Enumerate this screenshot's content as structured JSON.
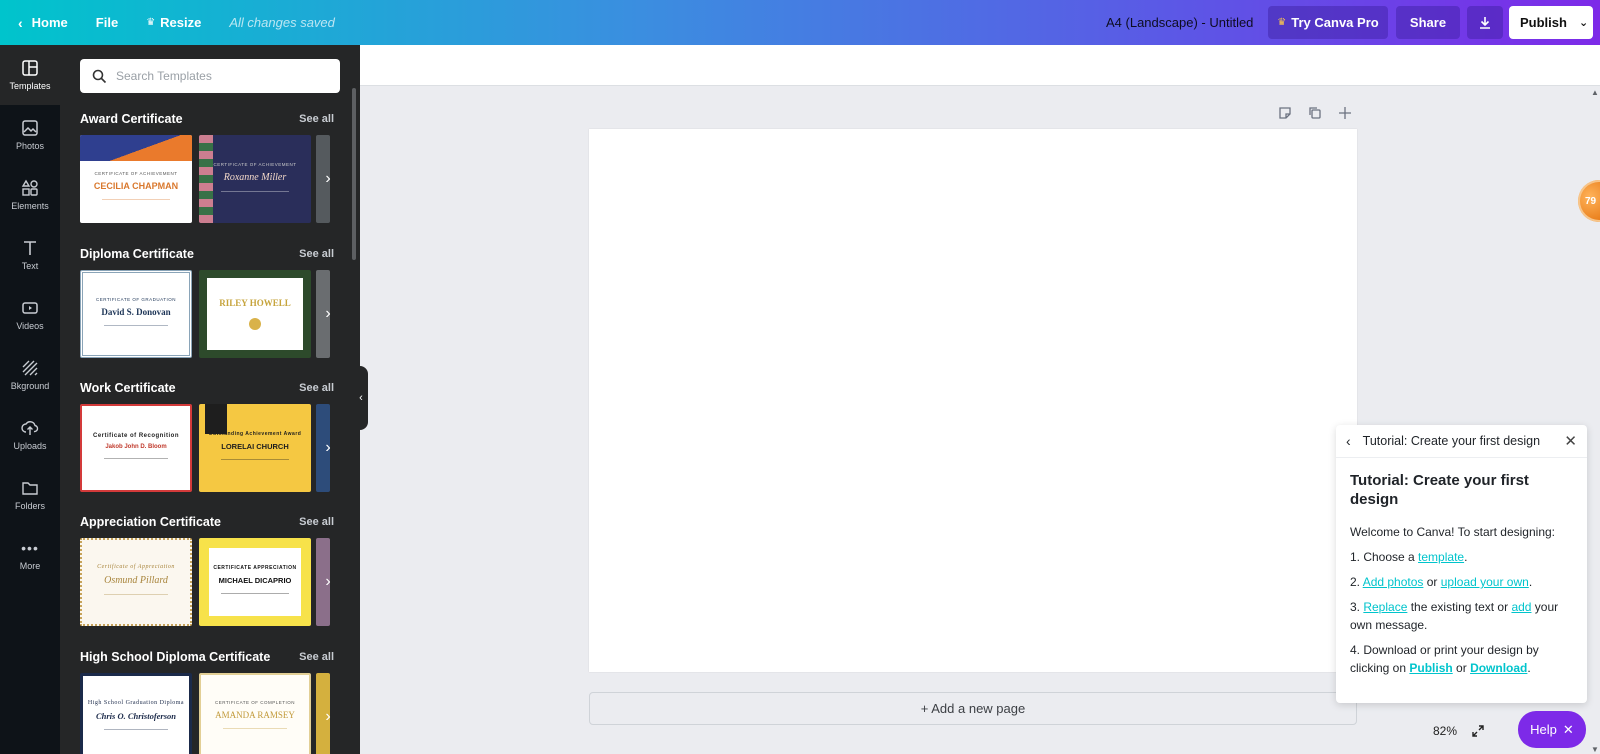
{
  "topbar": {
    "home": "Home",
    "file": "File",
    "resize": "Resize",
    "saved": "All changes saved",
    "doc_title": "A4 (Landscape) - Untitled",
    "try_pro": "Try Canva Pro",
    "share": "Share",
    "publish": "Publish"
  },
  "rail": {
    "items": [
      {
        "label": "Templates",
        "icon": "templates-icon"
      },
      {
        "label": "Photos",
        "icon": "photos-icon"
      },
      {
        "label": "Elements",
        "icon": "elements-icon"
      },
      {
        "label": "Text",
        "icon": "text-icon"
      },
      {
        "label": "Videos",
        "icon": "videos-icon"
      },
      {
        "label": "Bkground",
        "icon": "background-icon"
      },
      {
        "label": "Uploads",
        "icon": "uploads-icon"
      },
      {
        "label": "Folders",
        "icon": "folders-icon"
      },
      {
        "label": "More",
        "icon": "more-icon"
      }
    ]
  },
  "panel": {
    "search_placeholder": "Search Templates",
    "see_all": "See all",
    "sections": [
      {
        "title": "Award Certificate",
        "thumbs": [
          {
            "head": "CERTIFICATE OF ACHIEVEMENT",
            "name": "CECILIA CHAPMAN"
          },
          {
            "head": "CERTIFICATE OF ACHIEVEMENT",
            "name": "Roxanne Miller"
          }
        ]
      },
      {
        "title": "Diploma Certificate",
        "thumbs": [
          {
            "head": "CERTIFICATE OF GRADUATION",
            "name": "David S. Donovan"
          },
          {
            "head": "",
            "name": "RILEY HOWELL"
          }
        ]
      },
      {
        "title": "Work Certificate",
        "thumbs": [
          {
            "head": "Certificate of Recognition",
            "name": "Jakob John D. Bloom"
          },
          {
            "head": "Outstanding Achievement Award",
            "name": "LORELAI CHURCH"
          }
        ]
      },
      {
        "title": "Appreciation Certificate",
        "thumbs": [
          {
            "head": "Certificate of Appreciation",
            "name": "Osmund Pillard"
          },
          {
            "head": "CERTIFICATE APPRECIATION",
            "name": "MICHAEL DICAPRIO"
          }
        ]
      },
      {
        "title": "High School Diploma Certificate",
        "thumbs": [
          {
            "head": "High School Graduation Diploma",
            "name": "Chris O. Christoferson"
          },
          {
            "head": "CERTIFICATE OF COMPLETION",
            "name": "AMANDA RAMSEY"
          }
        ]
      }
    ]
  },
  "canvas": {
    "add_page": "+ Add a new page"
  },
  "tutorial": {
    "header": "Tutorial: Create your first design",
    "title": "Tutorial: Create your first design",
    "intro": "Welcome to Canva! To start designing:",
    "step1_pre": "1. Choose a ",
    "step1_link": "template",
    "step1_post": ".",
    "step2_pre": "2. ",
    "step2_link1": "Add photos",
    "step2_mid": " or ",
    "step2_link2": "upload your own",
    "step2_post": ".",
    "step3_pre": "3. ",
    "step3_link1": "Replace",
    "step3_mid": " the existing text or ",
    "step3_link2": "add",
    "step3_post": " your own message.",
    "step4_pre": "4. Download or print your design by clicking on ",
    "step4_link1": "Publish",
    "step4_mid": " or ",
    "step4_link2": "Download",
    "step4_post": "."
  },
  "zoom": {
    "value": "82%"
  },
  "help": {
    "label": "Help"
  },
  "badge": {
    "value": "79"
  },
  "colors": {
    "accent": "#00c4cc",
    "purple": "#7d2ae8",
    "panel": "#252627",
    "rail": "#0e1318"
  }
}
